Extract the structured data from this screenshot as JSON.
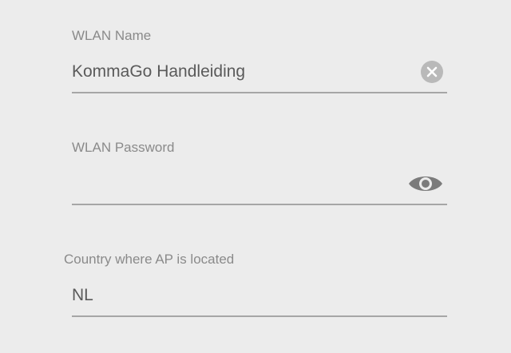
{
  "wlan_name": {
    "label": "WLAN Name",
    "value": "KommaGo Handleiding",
    "clear_icon": "clear-circle-icon"
  },
  "wlan_password": {
    "label": "WLAN Password",
    "value": "",
    "visibility_icon": "eye-icon"
  },
  "country": {
    "label": "Country where AP is located",
    "value": "NL"
  },
  "colors": {
    "background": "#ececec",
    "label": "#8a8a8a",
    "value": "#5a5a5a",
    "underline": "#a6a6a6",
    "icon": "#7b7b7b"
  }
}
